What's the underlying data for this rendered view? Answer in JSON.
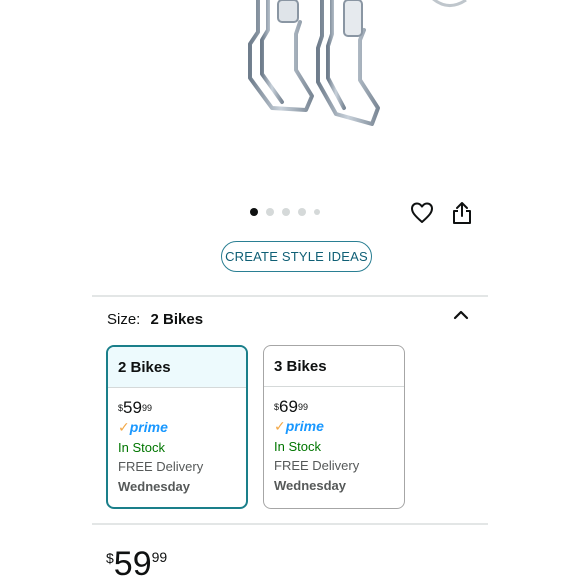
{
  "carousel": {
    "dot_count": 5,
    "active_index": 0
  },
  "icons": {
    "wishlist": "heart-icon",
    "share": "share-icon",
    "collapse": "chevron-up-icon"
  },
  "actions": {
    "create_style_ideas": "CREATE STYLE IDEAS"
  },
  "size": {
    "label": "Size:",
    "selected_value": "2 Bikes"
  },
  "options": [
    {
      "title": "2 Bikes",
      "currency": "$",
      "price_whole": "59",
      "price_fraction": "99",
      "prime_check": "✓",
      "prime_label": "prime",
      "stock": "In Stock",
      "delivery": "FREE Delivery",
      "delivery_day": "Wednesday",
      "selected": true
    },
    {
      "title": "3 Bikes",
      "currency": "$",
      "price_whole": "69",
      "price_fraction": "99",
      "prime_check": "✓",
      "prime_label": "prime",
      "stock": "In Stock",
      "delivery": "FREE Delivery",
      "delivery_day": "Wednesday",
      "selected": false
    }
  ],
  "price": {
    "currency": "$",
    "whole": "59",
    "fraction": "99"
  },
  "colors": {
    "accent": "#1a7f8a",
    "prime_blue": "#1a98ff",
    "in_stock": "#007600"
  }
}
